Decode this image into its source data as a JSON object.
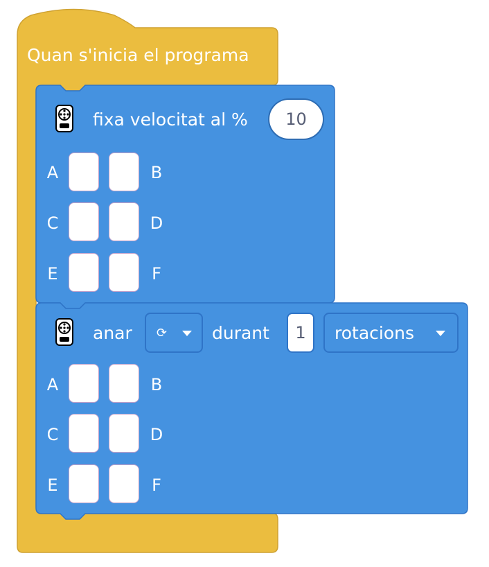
{
  "hat_block": {
    "label": "Quan s'inicia el programa",
    "color": "#EBBD3F"
  },
  "speed_block": {
    "icon": "motor-pair-icon",
    "label": "fixa velocitat al %",
    "value": "10",
    "color": "#4592E0",
    "ports_left": [
      "A",
      "C",
      "E"
    ],
    "ports_right": [
      "B",
      "D",
      "F"
    ]
  },
  "move_block": {
    "icon": "motor-pair-icon",
    "label": "anar",
    "direction_glyph": "⟳",
    "direction_icon": "rotate-clockwise-icon",
    "duration_label": "durant",
    "amount": "1",
    "unit_dropdown": "rotacions",
    "color": "#4592E0",
    "ports_left": [
      "A",
      "C",
      "E"
    ],
    "ports_right": [
      "B",
      "D",
      "F"
    ]
  }
}
